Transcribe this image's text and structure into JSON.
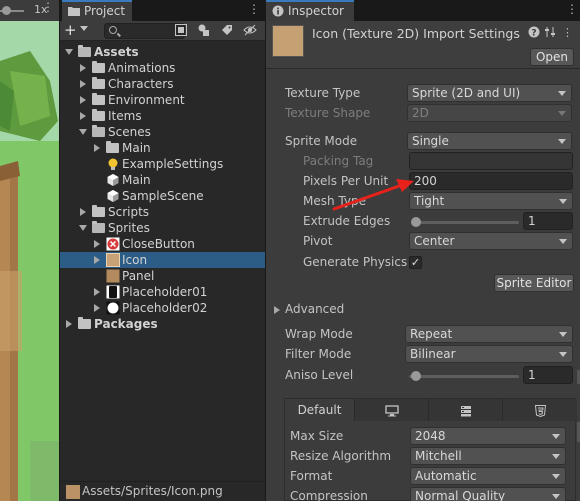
{
  "scene": {
    "zoom": "1x",
    "menu_icon": "kebab-menu-icon"
  },
  "project": {
    "tab_label": "Project",
    "tab_icon": "folder-icon",
    "toolbar": {
      "plus_label": "+",
      "search_placeholder": "",
      "icons": [
        "search-filter-icon",
        "type-filter-icon",
        "label-filter-icon",
        "hidden-packages-icon"
      ]
    },
    "tree": [
      {
        "label": "Assets",
        "level": 0,
        "kind": "folder",
        "expanded": true,
        "bold": true
      },
      {
        "label": "Animations",
        "level": 1,
        "kind": "folder",
        "expanded": false
      },
      {
        "label": "Characters",
        "level": 1,
        "kind": "folder",
        "expanded": false
      },
      {
        "label": "Environment",
        "level": 1,
        "kind": "folder",
        "expanded": false
      },
      {
        "label": "Items",
        "level": 1,
        "kind": "folder",
        "expanded": false
      },
      {
        "label": "Scenes",
        "level": 1,
        "kind": "folder",
        "expanded": true
      },
      {
        "label": "Main",
        "level": 2,
        "kind": "folder",
        "expanded": false
      },
      {
        "label": "ExampleSettings",
        "level": 2,
        "kind": "lighting-settings"
      },
      {
        "label": "Main",
        "level": 2,
        "kind": "scene"
      },
      {
        "label": "SampleScene",
        "level": 2,
        "kind": "scene"
      },
      {
        "label": "Scripts",
        "level": 1,
        "kind": "folder",
        "expanded": false
      },
      {
        "label": "Sprites",
        "level": 1,
        "kind": "folder",
        "expanded": true
      },
      {
        "label": "CloseButton",
        "level": 2,
        "kind": "sprite-close",
        "expandable": true
      },
      {
        "label": "Icon",
        "level": 2,
        "kind": "sprite-icon",
        "expandable": true,
        "selected": true
      },
      {
        "label": "Panel",
        "level": 2,
        "kind": "sprite-panel",
        "expandable": false
      },
      {
        "label": "Placeholder01",
        "level": 2,
        "kind": "sprite-placeholder-1",
        "expandable": true
      },
      {
        "label": "Placeholder02",
        "level": 2,
        "kind": "sprite-placeholder-2",
        "expandable": true
      },
      {
        "label": "Packages",
        "level": 0,
        "kind": "folder",
        "expanded": false,
        "bold": true
      }
    ],
    "path": "Assets/Sprites/Icon.png"
  },
  "inspector": {
    "tab_label": "Inspector",
    "tab_icon": "info-icon",
    "title": "Icon (Texture 2D) Import Settings",
    "open_button": "Open",
    "header_icons": [
      "help-icon",
      "presets-icon",
      "more-icon"
    ],
    "texture_type": {
      "label": "Texture Type",
      "value": "Sprite (2D and UI)"
    },
    "texture_shape": {
      "label": "Texture Shape",
      "value": "2D"
    },
    "sprite_mode": {
      "label": "Sprite Mode",
      "value": "Single"
    },
    "packing_tag": {
      "label": "Packing Tag",
      "value": ""
    },
    "pixels_per_unit": {
      "label": "Pixels Per Unit",
      "value": "200"
    },
    "mesh_type": {
      "label": "Mesh Type",
      "value": "Tight"
    },
    "extrude_edges": {
      "label": "Extrude Edges",
      "value": "1"
    },
    "pivot": {
      "label": "Pivot",
      "value": "Center"
    },
    "generate_physics": {
      "label": "Generate Physics S",
      "checked": true,
      "check_glyph": "✓"
    },
    "sprite_editor_button": "Sprite Editor",
    "advanced": {
      "label": "Advanced"
    },
    "wrap_mode": {
      "label": "Wrap Mode",
      "value": "Repeat"
    },
    "filter_mode": {
      "label": "Filter Mode",
      "value": "Bilinear"
    },
    "aniso_level": {
      "label": "Aniso Level",
      "value": "1"
    },
    "platform_tabs": [
      {
        "label": "Default",
        "icon": ""
      },
      {
        "label": "",
        "icon": "monitor-icon"
      },
      {
        "label": "",
        "icon": "server-icon"
      },
      {
        "label": "",
        "icon": "html5-icon"
      }
    ],
    "max_size": {
      "label": "Max Size",
      "value": "2048"
    },
    "resize_algorithm": {
      "label": "Resize Algorithm",
      "value": "Mitchell"
    },
    "format": {
      "label": "Format",
      "value": "Automatic"
    },
    "compression": {
      "label": "Compression",
      "value": "Normal Quality"
    }
  },
  "annotation": {
    "kind": "red-arrow",
    "points_to": "Pixels Per Unit field",
    "color": "#e8221b"
  },
  "colors": {
    "accent_tab": "#3a79bb",
    "selection": "#2c5d87",
    "panel_bg": "#3c3c3c",
    "tree_bg": "#282828"
  }
}
